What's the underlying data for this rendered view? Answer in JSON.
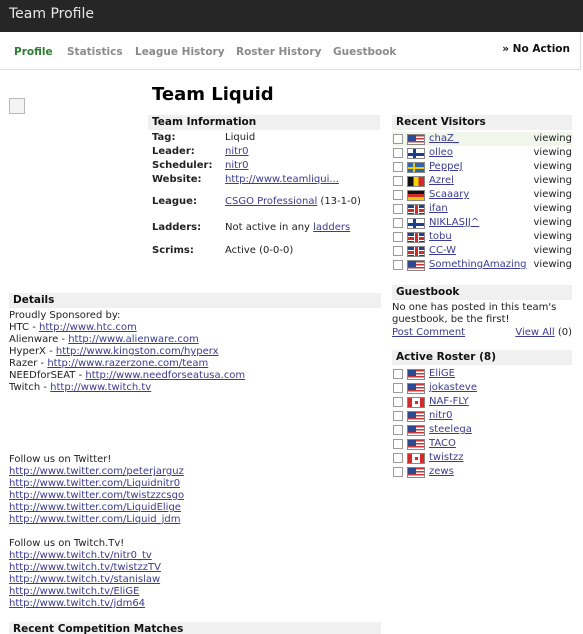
{
  "window": {
    "title": "Team Profile"
  },
  "tabs": [
    {
      "label": "Profile",
      "active": true
    },
    {
      "label": "Statistics"
    },
    {
      "label": "League History"
    },
    {
      "label": "Roster History"
    },
    {
      "label": "Guestbook"
    }
  ],
  "no_action": {
    "arrow": "»",
    "label": "No Action"
  },
  "team": {
    "name": "Team Liquid"
  },
  "team_info": {
    "heading": "Team Information",
    "tag_label": "Tag:",
    "tag": "Liquid",
    "leader_label": "Leader:",
    "leader": "nitr0",
    "scheduler_label": "Scheduler:",
    "scheduler": "nitr0",
    "website_label": "Website:",
    "website": "http://www.teamliqui...",
    "league_label": "League:",
    "league": "CSGO Professional",
    "league_record": "(13-1-0)",
    "ladders_label": "Ladders:",
    "ladders_prefix": "Not active in any",
    "ladders_link": "ladders",
    "scrims_label": "Scrims:",
    "scrims": "Active (0-0-0)"
  },
  "details": {
    "heading": "Details",
    "sponsored_line": "Proudly Sponsored by:",
    "sponsors": [
      {
        "name": "HTC - ",
        "url": "http://www.htc.com"
      },
      {
        "name": "Alienware - ",
        "url": "http://www.alienware.com"
      },
      {
        "name": "HyperX - ",
        "url": "http://www.kingston.com/hyperx"
      },
      {
        "name": "Razer - ",
        "url": "http://www.razerzone.com/team"
      },
      {
        "name": "NEEDforSEAT - ",
        "url": "http://www.needforseatusa.com"
      },
      {
        "name": "Twitch - ",
        "url": "http://www.twitch.tv"
      }
    ],
    "twitter_heading": "Follow us on Twitter!",
    "twitter_links": [
      "http://www.twitter.com/peterjarguz",
      "http://www.twitter.com/Liquidnitr0",
      "http://www.twitter.com/twistzzcsgo",
      "http://www.twitter.com/LiquidElige",
      "http://www.twitter.com/Liquid_jdm"
    ],
    "twitch_heading": "Follow us on Twitch.Tv!",
    "twitch_links": [
      "http://www.twitch.tv/nitr0_tv",
      "http://www.twitch.tv/twistzzTV",
      "http://www.twitch.tv/stanislaw",
      "http://www.twitch.tv/EliGE",
      "http://www.twitch.tv/jdm64"
    ]
  },
  "recent_matches": {
    "heading": "Recent Competition Matches"
  },
  "recent_visitors": {
    "heading": "Recent Visitors",
    "items": [
      {
        "name": "chaZ_",
        "flag": "us",
        "status": "viewing"
      },
      {
        "name": "olleo",
        "flag": "fi",
        "status": "viewing"
      },
      {
        "name": "PeppeJ",
        "flag": "se",
        "status": "viewing"
      },
      {
        "name": "Azrel",
        "flag": "be",
        "status": "viewing"
      },
      {
        "name": "Scaaary",
        "flag": "de",
        "status": "viewing"
      },
      {
        "name": "ifan",
        "flag": "gb",
        "status": "viewing"
      },
      {
        "name": "NIKLASJJ^",
        "flag": "fi",
        "status": "viewing"
      },
      {
        "name": "tobu",
        "flag": "gb",
        "status": "viewing"
      },
      {
        "name": "CC-W",
        "flag": "gb",
        "status": "viewing"
      },
      {
        "name": "SomethingAmazing",
        "flag": "us",
        "status": "viewing"
      }
    ]
  },
  "guestbook": {
    "heading": "Guestbook",
    "text": "No one has posted in this team's guestbook, be the first!",
    "post_comment": "Post Comment",
    "view_all": "View All",
    "count": "(0)"
  },
  "roster": {
    "heading": "Active Roster (8)",
    "items": [
      {
        "name": "EliGE",
        "flag": "us"
      },
      {
        "name": "jokasteve",
        "flag": "us"
      },
      {
        "name": "NAF-FLY",
        "flag": "ca"
      },
      {
        "name": "nitr0",
        "flag": "us"
      },
      {
        "name": "steelega",
        "flag": "us"
      },
      {
        "name": "TACO",
        "flag": "us"
      },
      {
        "name": "twistzz",
        "flag": "ca"
      },
      {
        "name": "zews",
        "flag": "us"
      }
    ]
  },
  "colors": {
    "active_tab": "#2e7d32",
    "link": "#3b3b8f",
    "titlebar": "#262626",
    "visitor_row_alt": "#f0f7ea"
  }
}
